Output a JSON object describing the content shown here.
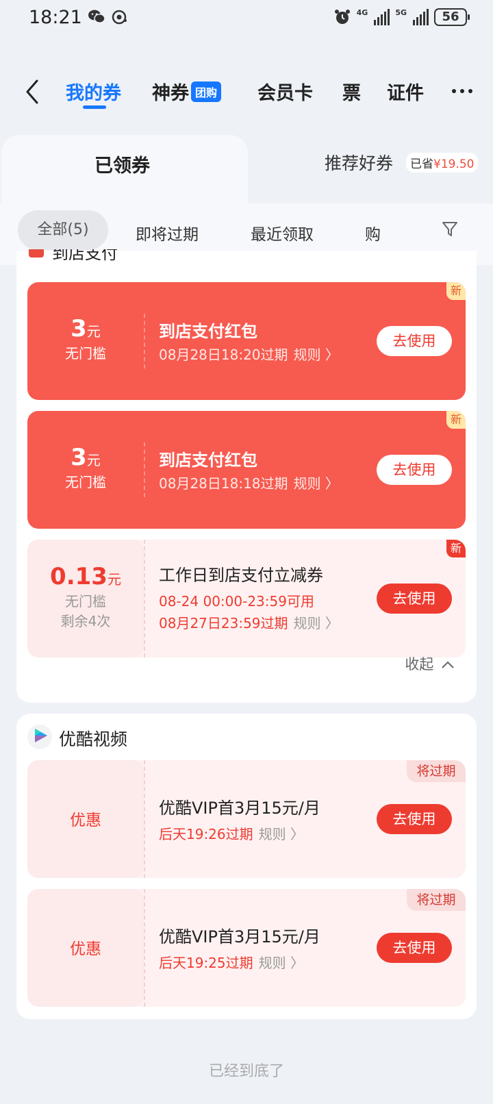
{
  "status_bar": {
    "time": "18:21",
    "battery": "56",
    "net1": "4G",
    "net2": "5G"
  },
  "nav": {
    "tabs": [
      "我的券",
      "神券",
      "会员卡",
      "票",
      "证件"
    ],
    "badge": "团购"
  },
  "segment": {
    "active": "已领券",
    "other": "推荐好券",
    "saved_prefix": "已省",
    "saved_amount": "¥19.50"
  },
  "filters": [
    "全部(5)",
    "即将过期",
    "最近领取",
    "购"
  ],
  "group1": {
    "header": "到店支付",
    "coupons": [
      {
        "amount": "3",
        "unit": "元",
        "condition": "无门槛",
        "title": "到店支付红包",
        "expire": "08月28日18:20过期",
        "rule": "规则 〉",
        "button": "去使用",
        "badge": "新"
      },
      {
        "amount": "3",
        "unit": "元",
        "condition": "无门槛",
        "title": "到店支付红包",
        "expire": "08月28日18:18过期",
        "rule": "规则 〉",
        "button": "去使用",
        "badge": "新"
      },
      {
        "amount": "0.13",
        "unit": "元",
        "condition": "无门槛",
        "remaining": "剩余4次",
        "title": "工作日到店支付立减券",
        "valid": "08-24 00:00-23:59可用",
        "expire": "08月27日23:59过期",
        "rule": "规则 〉",
        "button": "去使用",
        "badge": "新"
      }
    ],
    "collapse": "收起"
  },
  "group2": {
    "header": "优酷视频",
    "logo_text": "优酷",
    "coupons": [
      {
        "left": "优惠",
        "title": "优酷VIP首3月15元/月",
        "expire": "后天19:26过期",
        "rule": "规则 〉",
        "button": "去使用",
        "badge": "将过期"
      },
      {
        "left": "优惠",
        "title": "优酷VIP首3月15元/月",
        "expire": "后天19:25过期",
        "rule": "规则 〉",
        "button": "去使用",
        "badge": "将过期"
      }
    ]
  },
  "footer": "已经到底了"
}
